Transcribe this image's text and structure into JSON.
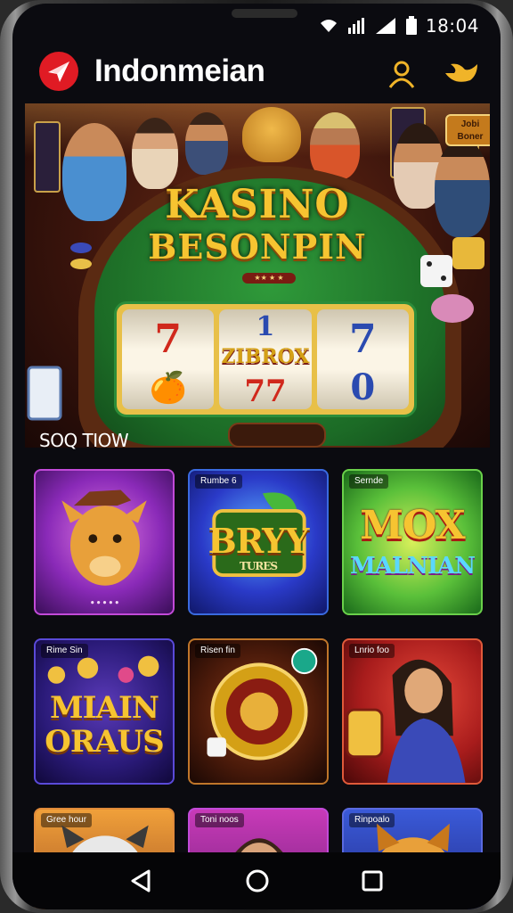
{
  "status_bar": {
    "time": "18:04",
    "icons": [
      "wifi-icon",
      "signal-icon",
      "signal-icon",
      "battery-icon"
    ]
  },
  "header": {
    "title": "Indonmeian",
    "icons": [
      "logo-icon",
      "user-icon",
      "bird-icon"
    ]
  },
  "banner": {
    "title_line1": "KASINO",
    "title_line2": "BESONPIN",
    "sign": "★★ ★ ★",
    "corner_badge": "Jobi Boner",
    "reels": [
      {
        "top": "7",
        "mid": "🍊",
        "bottom": ""
      },
      {
        "top": "1",
        "mid": "ZIBROX",
        "bottom": "77"
      },
      {
        "top": "7",
        "mid": "0",
        "bottom": ""
      }
    ]
  },
  "section_title": "SOQ TIOW",
  "games": [
    {
      "tag": "",
      "title": "",
      "subtitle": "• • • • •",
      "art": "lion-icon"
    },
    {
      "tag": "Rumbe 6",
      "title": "BRYY",
      "subtitle": "TURES",
      "art": "leaf-icon"
    },
    {
      "tag": "Sernde",
      "title": "MOX",
      "subtitle": "MALNIAN",
      "art": ""
    },
    {
      "tag": "Rime Sin",
      "title": "MIAIN",
      "subtitle": "ORAUS",
      "art": "coins-icon"
    },
    {
      "tag": "Risen fin",
      "title": "",
      "subtitle": "",
      "art": "roulette-icon"
    },
    {
      "tag": "Lnrio foo",
      "title": "",
      "subtitle": "",
      "art": "woman-icon"
    },
    {
      "tag": "Gree hour",
      "title": "",
      "subtitle": "",
      "art": "cat-icon"
    },
    {
      "tag": "Toni noos",
      "title": "",
      "subtitle": "",
      "art": "man-icon"
    },
    {
      "tag": "Rinpoalo",
      "title": "",
      "subtitle": "",
      "art": "fox-icon"
    }
  ],
  "nav": {
    "back": "back-icon",
    "home": "home-icon",
    "recents": "recents-icon"
  },
  "colors": {
    "accent": "#e01b24",
    "gold": "#f6c431",
    "felt": "#1c6b26",
    "background": "#0b0b10"
  }
}
